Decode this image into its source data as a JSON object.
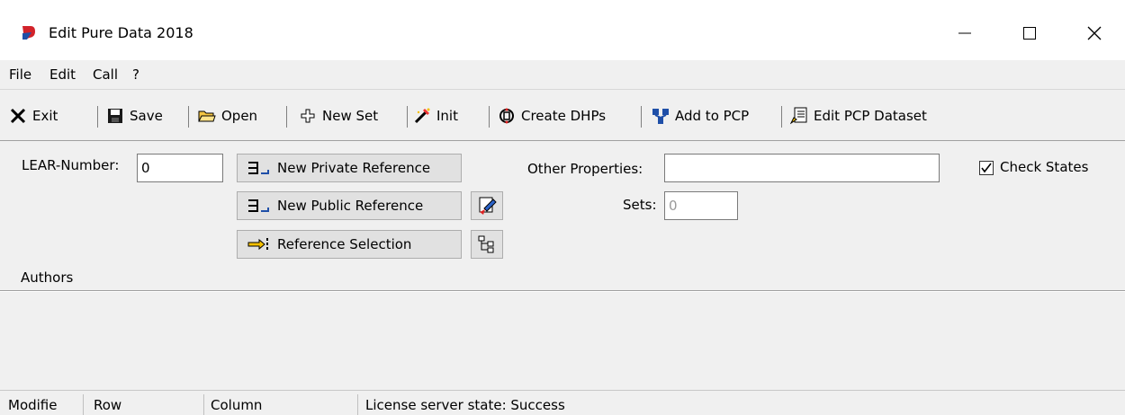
{
  "window": {
    "title": "Edit Pure Data 2018",
    "icon": "app-logo-icon",
    "controls": [
      "minimize-icon",
      "maximize-icon",
      "close-icon"
    ]
  },
  "menu": [
    "File",
    "Edit",
    "Call",
    "?"
  ],
  "toolbar": {
    "exit": "Exit",
    "save": "Save",
    "open": "Open",
    "new_set": "New Set",
    "init": "Init",
    "create_dhps": "Create DHPs",
    "add_to_pcp": "Add to PCP",
    "edit_pcp_dataset": "Edit PCP Dataset"
  },
  "form": {
    "lear_label": "LEAR-Number:",
    "lear_value": "0",
    "new_private_reference": "New Private Reference",
    "new_public_reference": "New Public Reference",
    "reference_selection": "Reference Selection",
    "other_properties_label": "Other Properties:",
    "other_properties_value": "",
    "sets_label": "Sets:",
    "sets_value": "0",
    "check_states_label": "Check States",
    "check_states_checked": true,
    "authors_label": "Authors"
  },
  "status": {
    "modified": "Modifie",
    "row": "Row",
    "column": "Column",
    "license": "License server state: Success"
  }
}
